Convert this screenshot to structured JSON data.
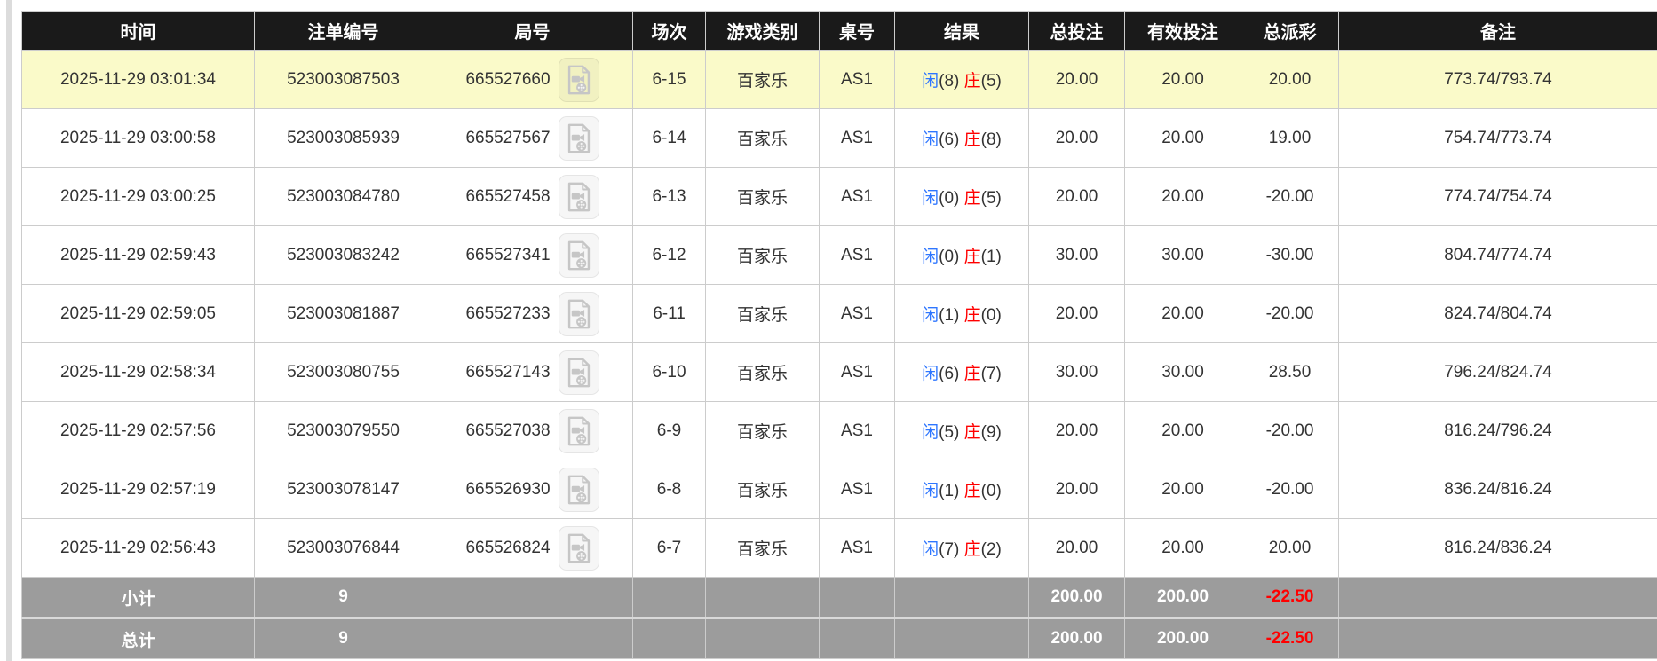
{
  "colors": {
    "header_bg": "#1a1a1a",
    "highlight_row_bg": "#fafac9",
    "summary_row_bg": "#9c9c9c",
    "player_blue": "#2e76ff",
    "banker_red": "#ff0000",
    "negative_red": "#ff0000"
  },
  "icons": {
    "video_replay": "video-replay-icon"
  },
  "table": {
    "columns": [
      {
        "key": "time",
        "label": "时间"
      },
      {
        "key": "bet-no",
        "label": "注单编号"
      },
      {
        "key": "round-no",
        "label": "局号"
      },
      {
        "key": "session",
        "label": "场次"
      },
      {
        "key": "game-type",
        "label": "游戏类别"
      },
      {
        "key": "table-no",
        "label": "桌号"
      },
      {
        "key": "result",
        "label": "结果"
      },
      {
        "key": "total-bet",
        "label": "总投注"
      },
      {
        "key": "valid-bet",
        "label": "有效投注"
      },
      {
        "key": "payout",
        "label": "总派彩"
      },
      {
        "key": "remark",
        "label": "备注"
      }
    ],
    "rows": [
      {
        "highlighted": true,
        "time": "2025-11-29 03:01:34",
        "bet_no": "523003087503",
        "round_no": "665527660",
        "session": "6-15",
        "game_type": "百家乐",
        "table_no": "AS1",
        "result": {
          "player": "闲",
          "player_count": "(8)",
          "banker": "庄",
          "banker_count": "(5)"
        },
        "total_bet": "20.00",
        "valid_bet": "20.00",
        "payout": "20.00",
        "remark": "773.74/793.74"
      },
      {
        "highlighted": false,
        "time": "2025-11-29 03:00:58",
        "bet_no": "523003085939",
        "round_no": "665527567",
        "session": "6-14",
        "game_type": "百家乐",
        "table_no": "AS1",
        "result": {
          "player": "闲",
          "player_count": "(6)",
          "banker": "庄",
          "banker_count": "(8)"
        },
        "total_bet": "20.00",
        "valid_bet": "20.00",
        "payout": "19.00",
        "remark": "754.74/773.74"
      },
      {
        "highlighted": false,
        "time": "2025-11-29 03:00:25",
        "bet_no": "523003084780",
        "round_no": "665527458",
        "session": "6-13",
        "game_type": "百家乐",
        "table_no": "AS1",
        "result": {
          "player": "闲",
          "player_count": "(0)",
          "banker": "庄",
          "banker_count": "(5)"
        },
        "total_bet": "20.00",
        "valid_bet": "20.00",
        "payout": "-20.00",
        "remark": "774.74/754.74"
      },
      {
        "highlighted": false,
        "time": "2025-11-29 02:59:43",
        "bet_no": "523003083242",
        "round_no": "665527341",
        "session": "6-12",
        "game_type": "百家乐",
        "table_no": "AS1",
        "result": {
          "player": "闲",
          "player_count": "(0)",
          "banker": "庄",
          "banker_count": "(1)"
        },
        "total_bet": "30.00",
        "valid_bet": "30.00",
        "payout": "-30.00",
        "remark": "804.74/774.74"
      },
      {
        "highlighted": false,
        "time": "2025-11-29 02:59:05",
        "bet_no": "523003081887",
        "round_no": "665527233",
        "session": "6-11",
        "game_type": "百家乐",
        "table_no": "AS1",
        "result": {
          "player": "闲",
          "player_count": "(1)",
          "banker": "庄",
          "banker_count": "(0)"
        },
        "total_bet": "20.00",
        "valid_bet": "20.00",
        "payout": "-20.00",
        "remark": "824.74/804.74"
      },
      {
        "highlighted": false,
        "time": "2025-11-29 02:58:34",
        "bet_no": "523003080755",
        "round_no": "665527143",
        "session": "6-10",
        "game_type": "百家乐",
        "table_no": "AS1",
        "result": {
          "player": "闲",
          "player_count": "(6)",
          "banker": "庄",
          "banker_count": "(7)"
        },
        "total_bet": "30.00",
        "valid_bet": "30.00",
        "payout": "28.50",
        "remark": "796.24/824.74"
      },
      {
        "highlighted": false,
        "time": "2025-11-29 02:57:56",
        "bet_no": "523003079550",
        "round_no": "665527038",
        "session": "6-9",
        "game_type": "百家乐",
        "table_no": "AS1",
        "result": {
          "player": "闲",
          "player_count": "(5)",
          "banker": "庄",
          "banker_count": "(9)"
        },
        "total_bet": "20.00",
        "valid_bet": "20.00",
        "payout": "-20.00",
        "remark": "816.24/796.24"
      },
      {
        "highlighted": false,
        "time": "2025-11-29 02:57:19",
        "bet_no": "523003078147",
        "round_no": "665526930",
        "session": "6-8",
        "game_type": "百家乐",
        "table_no": "AS1",
        "result": {
          "player": "闲",
          "player_count": "(1)",
          "banker": "庄",
          "banker_count": "(0)"
        },
        "total_bet": "20.00",
        "valid_bet": "20.00",
        "payout": "-20.00",
        "remark": "836.24/816.24"
      },
      {
        "highlighted": false,
        "time": "2025-11-29 02:56:43",
        "bet_no": "523003076844",
        "round_no": "665526824",
        "session": "6-7",
        "game_type": "百家乐",
        "table_no": "AS1",
        "result": {
          "player": "闲",
          "player_count": "(7)",
          "banker": "庄",
          "banker_count": "(2)"
        },
        "total_bet": "20.00",
        "valid_bet": "20.00",
        "payout": "20.00",
        "remark": "816.24/836.24"
      }
    ],
    "summary": [
      {
        "key": "subtotal",
        "label": "小计",
        "count": "9",
        "total_bet": "200.00",
        "valid_bet": "200.00",
        "payout": "-22.50",
        "remark": ""
      },
      {
        "key": "total",
        "label": "总计",
        "count": "9",
        "total_bet": "200.00",
        "valid_bet": "200.00",
        "payout": "-22.50",
        "remark": ""
      }
    ]
  }
}
